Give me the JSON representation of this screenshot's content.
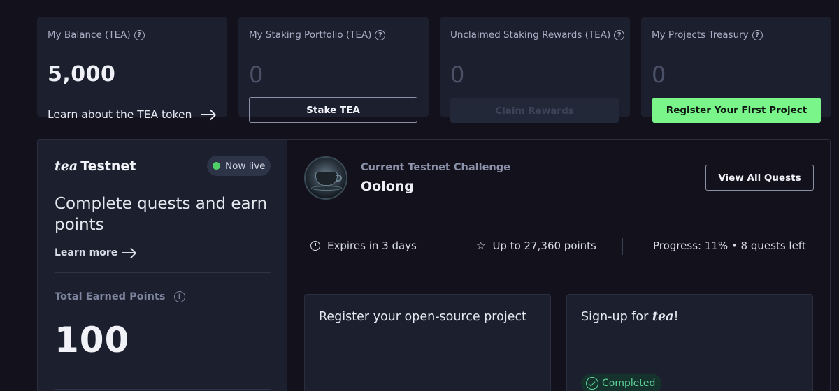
{
  "balance_cards": [
    {
      "title": "My Balance (TEA)",
      "value": "5,000",
      "link_label": "Learn about the TEA token"
    },
    {
      "title": "My Staking Portfolio (TEA)",
      "value": "0",
      "button_label": "Stake TEA"
    },
    {
      "title": "Unclaimed Staking Rewards (TEA)",
      "value": "0",
      "button_label": "Claim Rewards"
    },
    {
      "title": "My Projects Treasury",
      "value": "0",
      "button_label": "Register Your First Project"
    }
  ],
  "help_glyph": "?",
  "testnet": {
    "brand_italic": "tea",
    "brand_text": "Testnet",
    "status": "Now live",
    "status_color": "#4ecf68",
    "headline": "Complete quests and earn points",
    "learn_more": "Learn more",
    "earned_label": "Total Earned Points",
    "earned_value": "100"
  },
  "challenge": {
    "subtitle": "Current Testnet Challenge",
    "name": "Oolong",
    "view_all": "View All Quests",
    "expires": "Expires in 3 days",
    "reward": "Up to 27,360 points",
    "progress": "Progress: 11% • 8 quests left",
    "progress_percent": 11
  },
  "quests": [
    {
      "title": "Register your open-source project"
    },
    {
      "title_prefix": "Sign-up for ",
      "title_italic": "tea",
      "title_suffix": "!",
      "status": "Completed"
    }
  ],
  "colors": {
    "accent_green": "#7af58a",
    "background": "#13111c",
    "card": "#1b1f2e"
  },
  "icons": [
    "help-icon",
    "arrow-right-icon",
    "live-dot-icon",
    "info-icon",
    "clock-icon",
    "star-icon",
    "check-circle-icon",
    "teacup-image"
  ]
}
